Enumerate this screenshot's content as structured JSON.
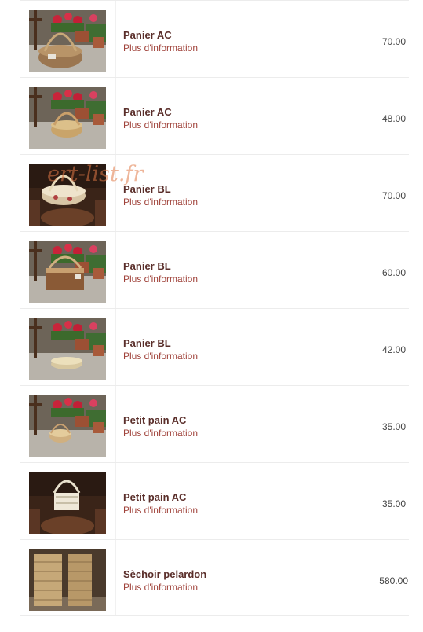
{
  "products": [
    {
      "name": "Panier AC",
      "more_label": "Plus d'information",
      "price": "70.00",
      "photo": "basket-large-flowers"
    },
    {
      "name": "Panier AC",
      "more_label": "Plus d'information",
      "price": "48.00",
      "photo": "basket-small-flowers"
    },
    {
      "name": "Panier BL",
      "more_label": "Plus d'information",
      "price": "70.00",
      "photo": "basket-white-dark"
    },
    {
      "name": "Panier BL",
      "more_label": "Plus d'information",
      "price": "60.00",
      "photo": "basket-square-flowers"
    },
    {
      "name": "Panier BL",
      "more_label": "Plus d'information",
      "price": "42.00",
      "photo": "basket-flat-flowers"
    },
    {
      "name": "Petit pain AC",
      "more_label": "Plus d'information",
      "price": "35.00",
      "photo": "basket-tiny-flowers"
    },
    {
      "name": "Petit pain AC",
      "more_label": "Plus d'information",
      "price": "35.00",
      "photo": "basket-white-dark"
    },
    {
      "name": "Sèchoir pelardon",
      "more_label": "Plus d'information",
      "price": "580.00",
      "photo": "drying-rack"
    }
  ],
  "watermark": "ert-list.fr",
  "colors": {
    "product_name": "#5a2e2a",
    "link": "#a0433b",
    "price": "#444444",
    "row_border": "#ececec"
  }
}
